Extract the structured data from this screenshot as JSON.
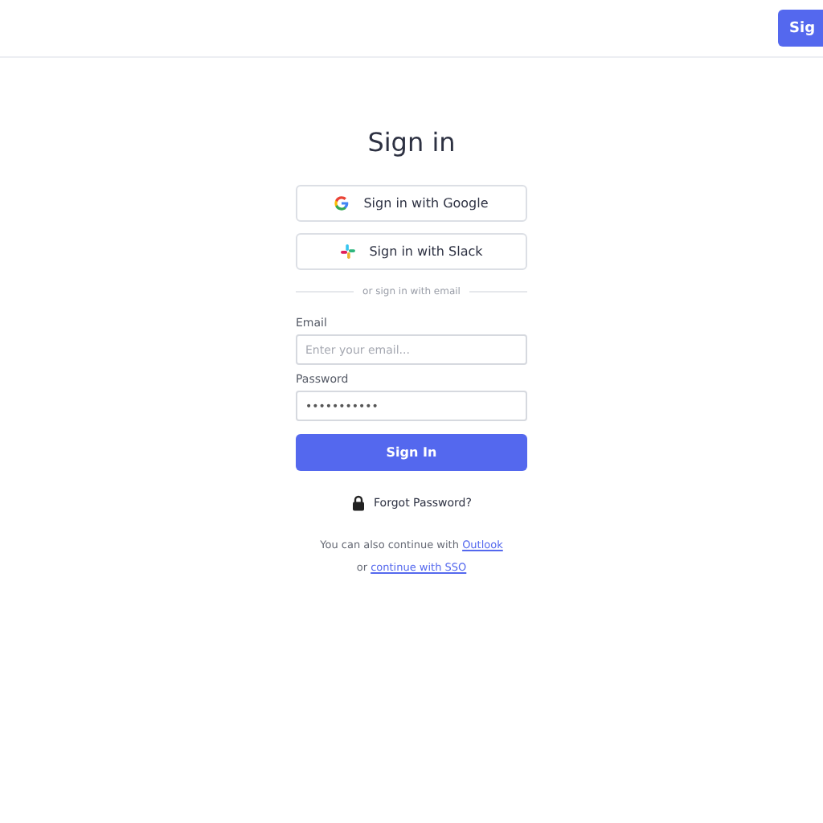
{
  "header": {
    "button": "Sig"
  },
  "title": "Sign in",
  "providers": [
    {
      "kind": "google",
      "label": "Sign in with Google"
    },
    {
      "kind": "slack",
      "label": "Sign in with Slack"
    }
  ],
  "divider": "or sign in with email",
  "fields": [
    {
      "label": "Email",
      "placeholder": "Enter your email..."
    },
    {
      "label": "Password",
      "value": "•••••••••••"
    }
  ],
  "submit": "Sign In",
  "forgot": "Forgot Password?",
  "alt_line": {
    "text": "You can also continue with",
    "link": "Outlook"
  },
  "sso_line": {
    "text": "or",
    "link": "continue with SSO"
  }
}
